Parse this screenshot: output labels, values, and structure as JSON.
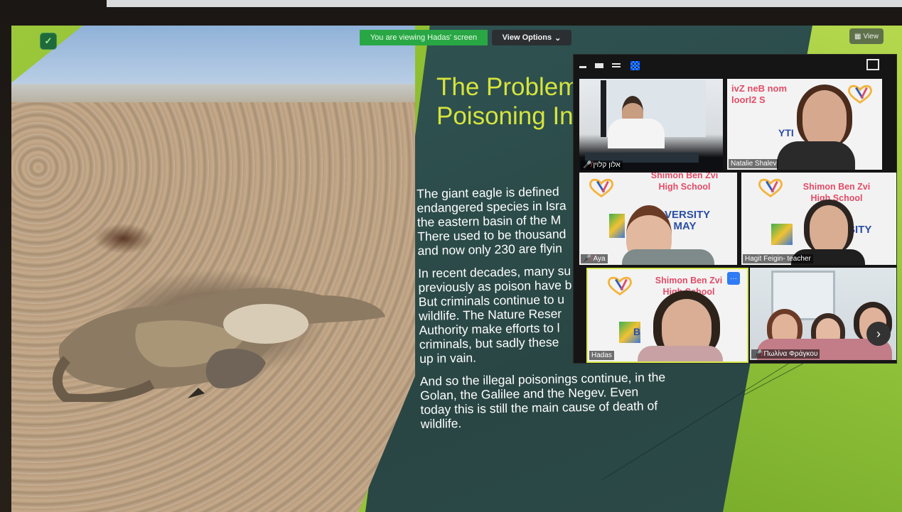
{
  "banner": {
    "viewing_text": "You are viewing Hadas' screen",
    "view_options_label": "View Options",
    "view_label": "View"
  },
  "slide": {
    "title": "The Problem\nPoisoning In",
    "paragraphs": [
      "The giant eagle is defined\nendangered species in Isra\nthe eastern basin of the M\nThere used to be thousand\nand now only 230 are flyin",
      "In recent decades, many su\npreviously as poison have b\nBut criminals continue to u\nwildlife. The Nature Reser\nAuthority make efforts to l\ncriminals, but sadly these\nup in vain.",
      "And so the illegal poisonings continue, in the\nGolan, the Galilee and the Negev. Even\ntoday this is still the main cause of death of\nwildlife."
    ]
  },
  "participants": [
    {
      "name": "אלון קלוין",
      "muted": true
    },
    {
      "name": "Natalie Shalev",
      "muted": false,
      "sign_text": "ivZ neB nom\nloorl2 S",
      "sign_extra": "YTI"
    },
    {
      "name": "Aya",
      "muted": true,
      "school_text": "Shimon Ben Zvi\nHigh School",
      "sign_extra": "VERSITY\n2 MAY"
    },
    {
      "name": "Hagit Feigin- teacher",
      "muted": false,
      "school_text": "Shimon Ben Zvi\nHigh School",
      "sign_extra": "SITY"
    },
    {
      "name": "Hadas",
      "muted": false,
      "school_text": "Shimon Ben Zvi\nHigh School",
      "sign_extra": "B"
    },
    {
      "name": "Πωλίνα Φράγκου",
      "muted": true
    }
  ],
  "icons": {
    "shield": "shield-check-icon",
    "view_options_chevron": "chevron-down-icon",
    "view": "grid-view-icon",
    "minimize": "minimize-icon",
    "speaker_view": "speaker-view-icon",
    "strip_view": "strip-view-icon",
    "gallery_view": "gallery-view-icon",
    "exit_fullscreen": "exit-fullscreen-icon",
    "next_page": "chevron-right-icon",
    "more": "more-options-icon",
    "mic_off": "mic-off-icon"
  },
  "colors": {
    "banner_green": "#29a745",
    "slide_title": "#d6e43c",
    "accent_green": "#9bc83a",
    "slide_dark": "#2f5352",
    "mute_red": "#ff4b4b"
  },
  "glyphs": {
    "chevron_down": "⌄",
    "chevron_right": "›",
    "more": "···",
    "mic_off": "🎤̸",
    "check": "✓",
    "view_icon": "▦"
  }
}
